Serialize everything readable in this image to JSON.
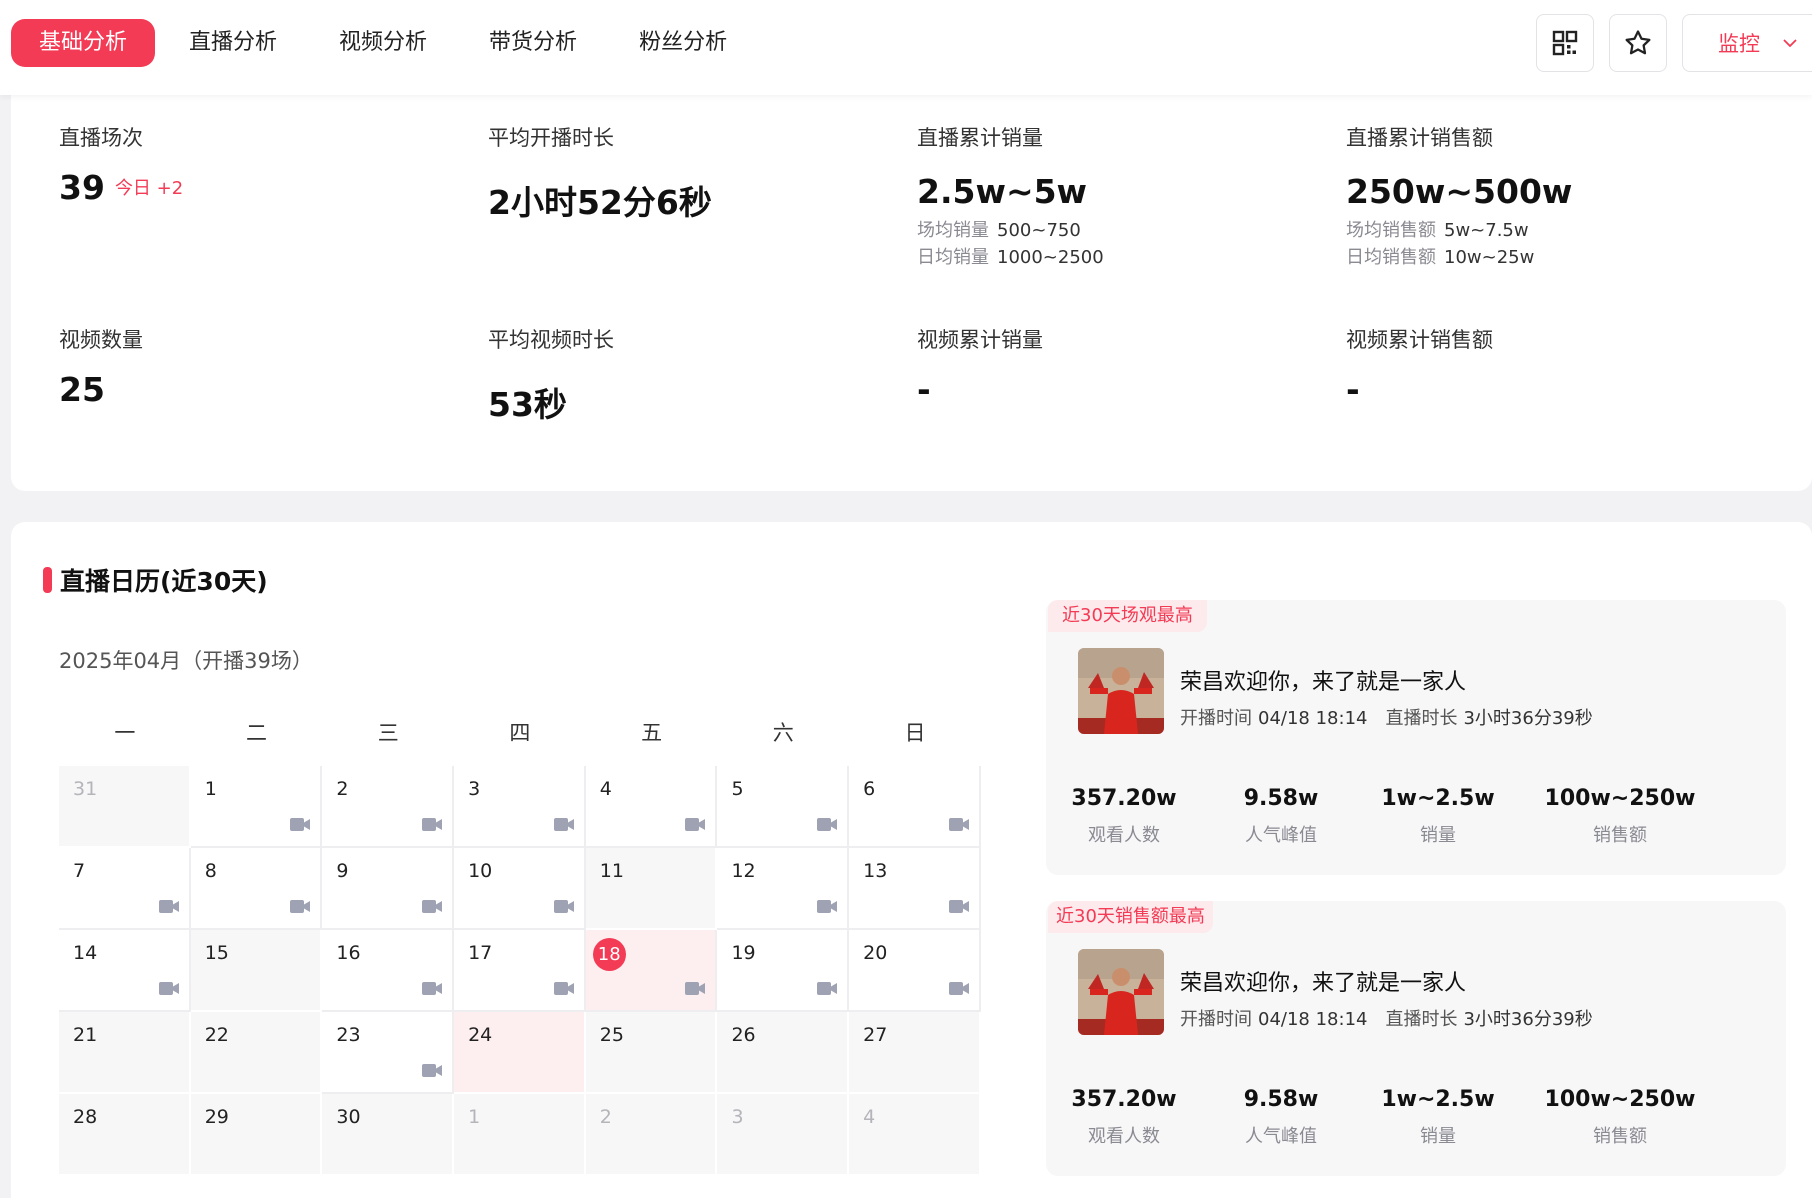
{
  "nav": {
    "tabs": [
      {
        "label": "基础分析",
        "active": true
      },
      {
        "label": "直播分析",
        "active": false
      },
      {
        "label": "视频分析",
        "active": false
      },
      {
        "label": "带货分析",
        "active": false
      },
      {
        "label": "粉丝分析",
        "active": false
      }
    ],
    "monitor_label": "监控",
    "accent_color": "#f33b55",
    "icons": [
      "qr-code-icon",
      "star-icon",
      "chevron-down-icon"
    ]
  },
  "stats": {
    "live_count": {
      "label": "直播场次",
      "value": "39",
      "today_label": "今日",
      "today_value": "+2"
    },
    "avg_live_duration": {
      "label": "平均开播时长",
      "value": "2小时52分6秒"
    },
    "live_sales_volume": {
      "label": "直播累计销量",
      "value": "2.5w~5w",
      "sub1_label": "场均销量",
      "sub1_value": "500~750",
      "sub2_label": "日均销量",
      "sub2_value": "1000~2500"
    },
    "live_sales_amount": {
      "label": "直播累计销售额",
      "value": "250w~500w",
      "sub1_label": "场均销售额",
      "sub1_value": "5w~7.5w",
      "sub2_label": "日均销售额",
      "sub2_value": "10w~25w"
    },
    "video_count": {
      "label": "视频数量",
      "value": "25"
    },
    "avg_video_duration": {
      "label": "平均视频时长",
      "value": "53秒"
    },
    "video_sales_volume": {
      "label": "视频累计销量",
      "value": "-"
    },
    "video_sales_amount": {
      "label": "视频累计销售额",
      "value": "-"
    }
  },
  "calendar": {
    "title": "直播日历(近30天)",
    "month_label": "2025年04月（开播39场）",
    "weekdays": [
      "一",
      "二",
      "三",
      "四",
      "五",
      "六",
      "日"
    ],
    "weeks": [
      [
        {
          "d": "31",
          "other": true,
          "live": false
        },
        {
          "d": "1",
          "live": true
        },
        {
          "d": "2",
          "live": true
        },
        {
          "d": "3",
          "live": true
        },
        {
          "d": "4",
          "live": true
        },
        {
          "d": "5",
          "live": true
        },
        {
          "d": "6",
          "live": true
        }
      ],
      [
        {
          "d": "7",
          "live": true
        },
        {
          "d": "8",
          "live": true
        },
        {
          "d": "9",
          "live": true
        },
        {
          "d": "10",
          "live": true
        },
        {
          "d": "11",
          "live": false
        },
        {
          "d": "12",
          "live": true
        },
        {
          "d": "13",
          "live": true
        }
      ],
      [
        {
          "d": "14",
          "live": true
        },
        {
          "d": "15",
          "live": false
        },
        {
          "d": "16",
          "live": true
        },
        {
          "d": "17",
          "live": true
        },
        {
          "d": "18",
          "live": true,
          "today": true
        },
        {
          "d": "19",
          "live": true
        },
        {
          "d": "20",
          "live": true
        }
      ],
      [
        {
          "d": "21",
          "live": false
        },
        {
          "d": "22",
          "live": false
        },
        {
          "d": "23",
          "live": true
        },
        {
          "d": "24",
          "live": false,
          "hl": true
        },
        {
          "d": "25",
          "live": false
        },
        {
          "d": "26",
          "live": false
        },
        {
          "d": "27",
          "live": false
        }
      ],
      [
        {
          "d": "28",
          "live": false
        },
        {
          "d": "29",
          "live": false
        },
        {
          "d": "30",
          "live": false
        },
        {
          "d": "1",
          "other": true,
          "live": false
        },
        {
          "d": "2",
          "other": true,
          "live": false
        },
        {
          "d": "3",
          "other": true,
          "live": false
        },
        {
          "d": "4",
          "other": true,
          "live": false
        }
      ]
    ]
  },
  "top_views": {
    "tag": "近30天场观最高",
    "title": "荣昌欢迎你，来了就是一家人",
    "start_label": "开播时间",
    "start_value": "04/18 18:14",
    "duration_label": "直播时长",
    "duration_value": "3小时36分39秒",
    "metrics": [
      {
        "value": "357.20w",
        "label": "观看人数"
      },
      {
        "value": "9.58w",
        "label": "人气峰值"
      },
      {
        "value": "1w~2.5w",
        "label": "销量"
      },
      {
        "value": "100w~250w",
        "label": "销售额"
      }
    ]
  },
  "top_sales": {
    "tag": "近30天销售额最高",
    "title": "荣昌欢迎你，来了就是一家人",
    "start_label": "开播时间",
    "start_value": "04/18 18:14",
    "duration_label": "直播时长",
    "duration_value": "3小时36分39秒",
    "metrics": [
      {
        "value": "357.20w",
        "label": "观看人数"
      },
      {
        "value": "9.58w",
        "label": "人气峰值"
      },
      {
        "value": "1w~2.5w",
        "label": "销量"
      },
      {
        "value": "100w~250w",
        "label": "销售额"
      }
    ]
  }
}
